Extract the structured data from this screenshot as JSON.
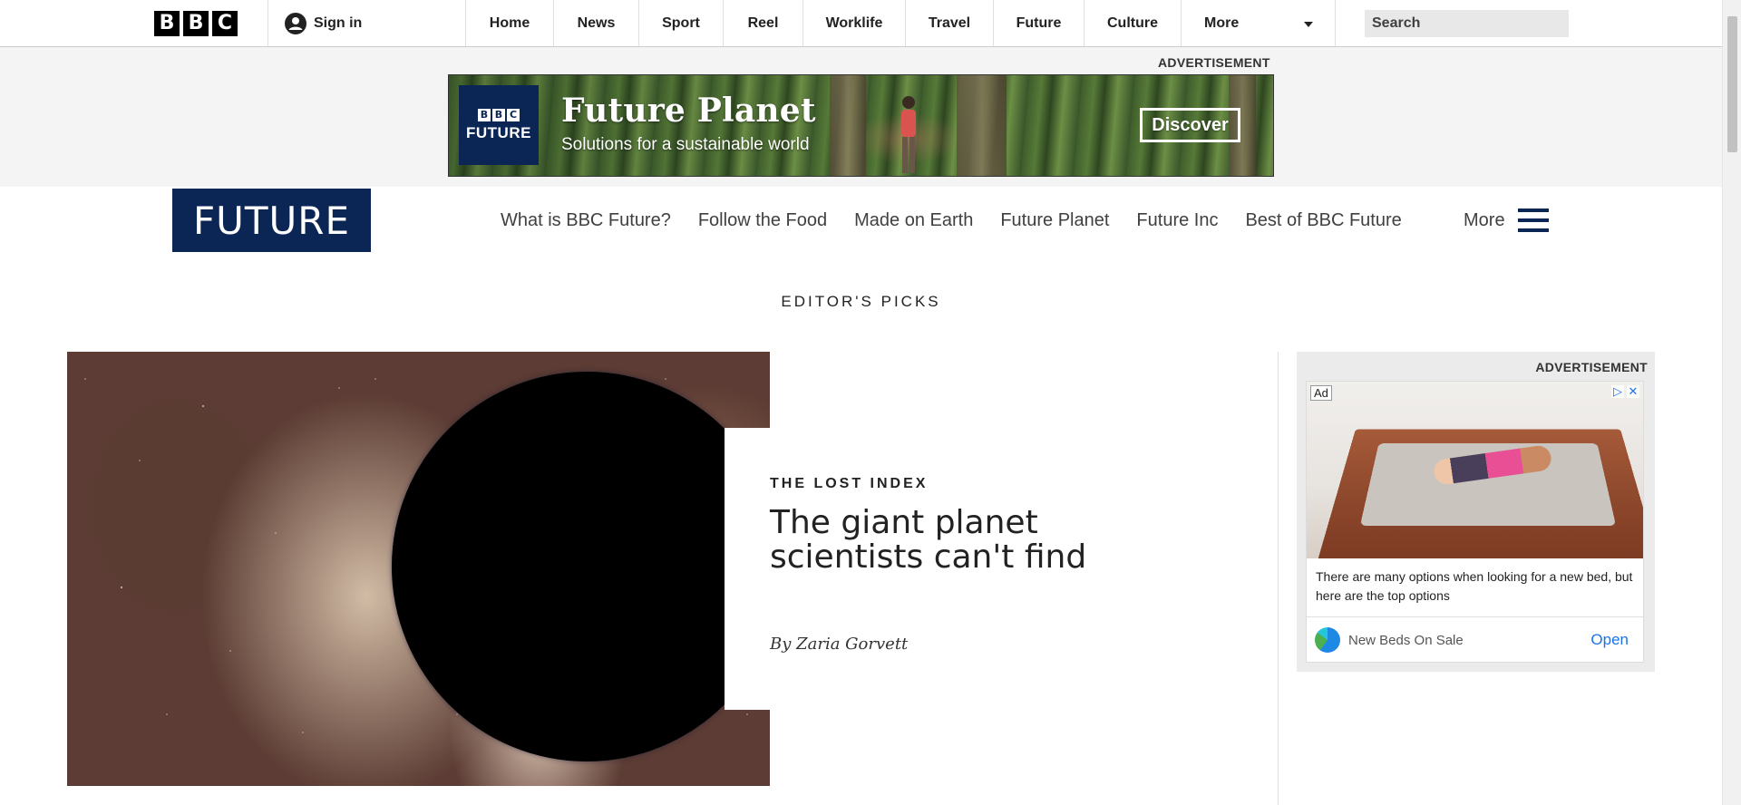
{
  "topbar": {
    "logo_letters": [
      "B",
      "B",
      "C"
    ],
    "sign_in": "Sign in",
    "nav": [
      {
        "label": "Home"
      },
      {
        "label": "News"
      },
      {
        "label": "Sport"
      },
      {
        "label": "Reel"
      },
      {
        "label": "Worklife"
      },
      {
        "label": "Travel"
      },
      {
        "label": "Future"
      },
      {
        "label": "Culture"
      }
    ],
    "more": "More",
    "search_placeholder": "Search"
  },
  "top_ad": {
    "label": "ADVERTISEMENT",
    "brand_letters": [
      "B",
      "B",
      "C"
    ],
    "brand_word": "FUTURE",
    "title": "Future Planet",
    "subtitle": "Solutions for a sustainable world",
    "cta": "Discover"
  },
  "section": {
    "logo": "FUTURE",
    "nav": [
      {
        "label": "What is BBC Future?"
      },
      {
        "label": "Follow the Food"
      },
      {
        "label": "Made on Earth"
      },
      {
        "label": "Future Planet"
      },
      {
        "label": "Future Inc"
      },
      {
        "label": "Best of BBC Future"
      }
    ],
    "more": "More"
  },
  "editors_picks": {
    "heading": "EDITOR'S PICKS",
    "article": {
      "kicker": "THE LOST INDEX",
      "headline": "The giant planet scientists can't find",
      "byline": "By Zaria Gorvett"
    }
  },
  "side_ad": {
    "label": "ADVERTISEMENT",
    "ad_tag": "Ad",
    "text": "There are many options when looking for a new bed, but here are the top options",
    "advertiser": "New Beds On Sale",
    "cta": "Open"
  },
  "colors": {
    "brand_navy": "#0b2655",
    "link_blue": "#1a73e8",
    "ad_band": "#f4f4f4"
  }
}
